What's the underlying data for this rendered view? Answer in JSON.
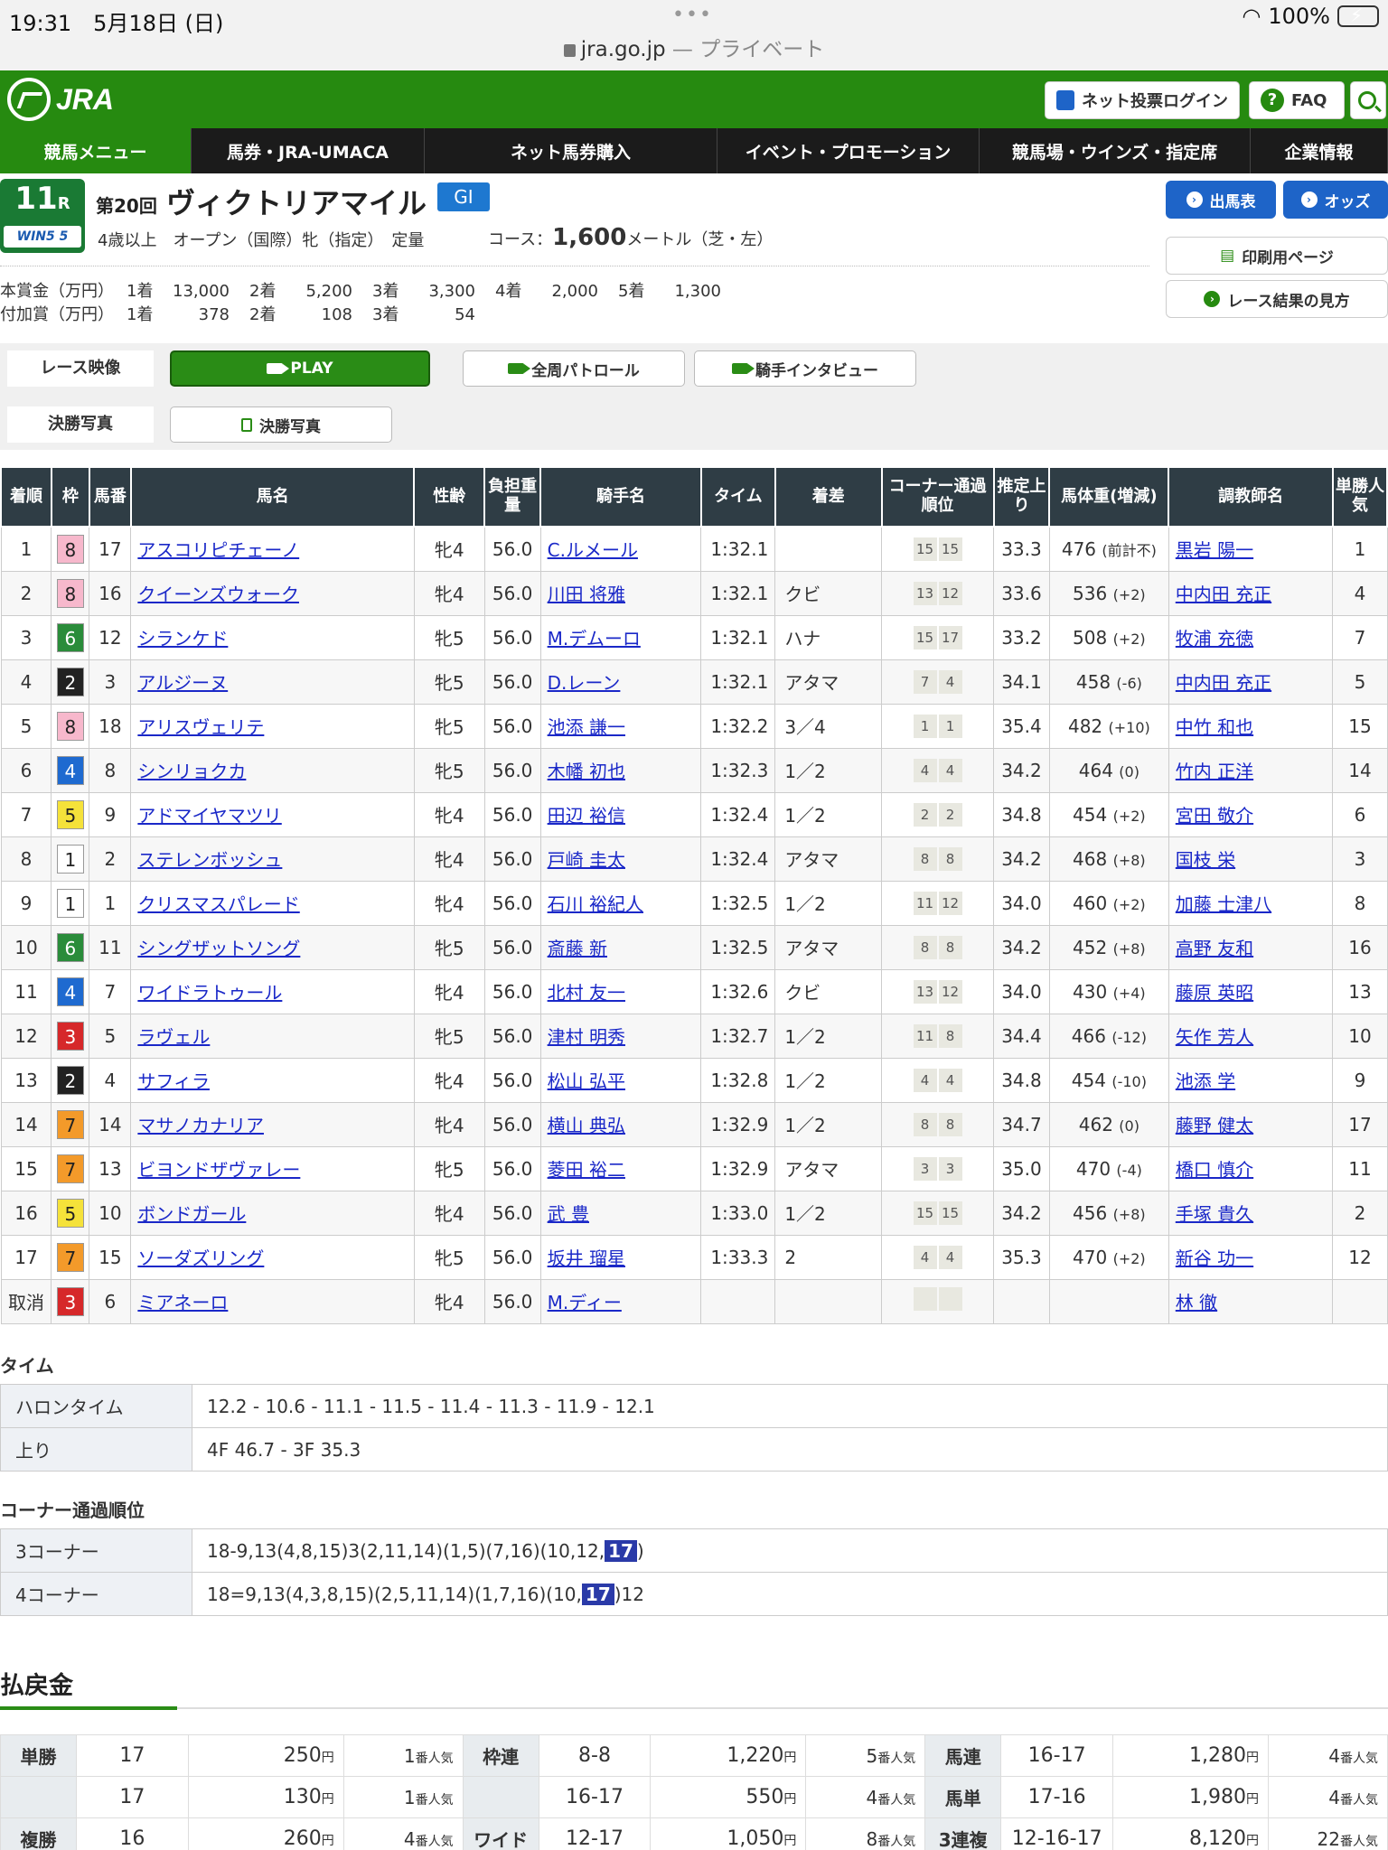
{
  "status": {
    "time": "19:31",
    "date": "5月18日 (日)",
    "battery": "100%"
  },
  "browser": {
    "domain": "jra.go.jp",
    "mode": "— プライベート"
  },
  "header": {
    "logo": "JRA",
    "login_label": "ネット投票ログイン",
    "faq_label": "FAQ"
  },
  "nav": [
    {
      "label": "競馬メニュー",
      "w": 212
    },
    {
      "label": "馬券・JRA-UMACA",
      "w": 258
    },
    {
      "label": "ネット馬券購入",
      "w": 324
    },
    {
      "label": "イベント・プロモーション",
      "w": 290
    },
    {
      "label": "競馬場・ウインズ・指定席",
      "w": 300
    },
    {
      "label": "企業情報",
      "w": 152
    }
  ],
  "race": {
    "number": "11",
    "r": "R",
    "win5": "WIN5 5",
    "count": "第20回",
    "name": "ヴィクトリアマイル",
    "grade": "GI",
    "conditions": "4歳以上　オープン（国際）牝（指定）　定量",
    "course_label": "コース：",
    "distance": "1,600",
    "course_unit": "メートル（芝・左）",
    "prize_main": {
      "label": "本賞金（万円）",
      "items": [
        "1着",
        "13,000",
        "2着",
        "5,200",
        "3着",
        "3,300",
        "4着",
        "2,000",
        "5着",
        "1,300"
      ]
    },
    "prize_add": {
      "label": "付加賞（万円）",
      "items": [
        "1着",
        "378",
        "2着",
        "108",
        "3着",
        "54"
      ]
    }
  },
  "side_buttons": {
    "entries": "出馬表",
    "odds": "オッズ",
    "print": "印刷用ページ",
    "guide": "レース結果の見方"
  },
  "video": {
    "label": "レース映像",
    "play": "PLAY",
    "patrol": "全周パトロール",
    "interview": "騎手インタビュー",
    "photo_label": "決勝写真",
    "photo_btn": "決勝写真"
  },
  "table_headers": [
    "着順",
    "枠",
    "馬番",
    "馬名",
    "性齢",
    "負担重量",
    "騎手名",
    "タイム",
    "着差",
    "コーナー通過順位",
    "推定上り",
    "馬体重(増減)",
    "調教師名",
    "単勝人気"
  ],
  "waku_colors": {
    "1": {
      "bg": "#ffffff",
      "fg": "#222222"
    },
    "2": {
      "bg": "#222222",
      "fg": "#ffffff"
    },
    "3": {
      "bg": "#d6282a",
      "fg": "#ffffff"
    },
    "4": {
      "bg": "#1e6ad0",
      "fg": "#ffffff"
    },
    "5": {
      "bg": "#f5e23a",
      "fg": "#222222"
    },
    "6": {
      "bg": "#2a8c3a",
      "fg": "#ffffff"
    },
    "7": {
      "bg": "#f39a2a",
      "fg": "#222222"
    },
    "8": {
      "bg": "#f7b8cc",
      "fg": "#222222"
    }
  },
  "results": [
    {
      "place": "1",
      "waku": "8",
      "num": "17",
      "horse": "アスコリピチェーノ",
      "sex_age": "牝4",
      "weight": "56.0",
      "jockey": "C.ルメール",
      "time": "1:32.1",
      "margin": "",
      "corners": [
        "15",
        "15"
      ],
      "last3f": "33.3",
      "body": "476",
      "diff": "(前計不)",
      "trainer": "黒岩 陽一",
      "pop": "1"
    },
    {
      "place": "2",
      "waku": "8",
      "num": "16",
      "horse": "クイーンズウォーク",
      "sex_age": "牝4",
      "weight": "56.0",
      "jockey": "川田 将雅",
      "time": "1:32.1",
      "margin": "クビ",
      "corners": [
        "13",
        "12"
      ],
      "last3f": "33.6",
      "body": "536",
      "diff": "(+2)",
      "trainer": "中内田 充正",
      "pop": "4"
    },
    {
      "place": "3",
      "waku": "6",
      "num": "12",
      "horse": "シランケド",
      "sex_age": "牝5",
      "weight": "56.0",
      "jockey": "M.デムーロ",
      "time": "1:32.1",
      "margin": "ハナ",
      "corners": [
        "15",
        "17"
      ],
      "last3f": "33.2",
      "body": "508",
      "diff": "(+2)",
      "trainer": "牧浦 充徳",
      "pop": "7"
    },
    {
      "place": "4",
      "waku": "2",
      "num": "3",
      "horse": "アルジーヌ",
      "sex_age": "牝5",
      "weight": "56.0",
      "jockey": "D.レーン",
      "time": "1:32.1",
      "margin": "アタマ",
      "corners": [
        "7",
        "4"
      ],
      "last3f": "34.1",
      "body": "458",
      "diff": "(-6)",
      "trainer": "中内田 充正",
      "pop": "5"
    },
    {
      "place": "5",
      "waku": "8",
      "num": "18",
      "horse": "アリスヴェリテ",
      "sex_age": "牝5",
      "weight": "56.0",
      "jockey": "池添 謙一",
      "time": "1:32.2",
      "margin": "3／4",
      "corners": [
        "1",
        "1"
      ],
      "last3f": "35.4",
      "body": "482",
      "diff": "(+10)",
      "trainer": "中竹 和也",
      "pop": "15"
    },
    {
      "place": "6",
      "waku": "4",
      "num": "8",
      "horse": "シンリョクカ",
      "sex_age": "牝5",
      "weight": "56.0",
      "jockey": "木幡 初也",
      "time": "1:32.3",
      "margin": "1／2",
      "corners": [
        "4",
        "4"
      ],
      "last3f": "34.2",
      "body": "464",
      "diff": "(0)",
      "trainer": "竹内 正洋",
      "pop": "14"
    },
    {
      "place": "7",
      "waku": "5",
      "num": "9",
      "horse": "アドマイヤマツリ",
      "sex_age": "牝4",
      "weight": "56.0",
      "jockey": "田辺 裕信",
      "time": "1:32.4",
      "margin": "1／2",
      "corners": [
        "2",
        "2"
      ],
      "last3f": "34.8",
      "body": "454",
      "diff": "(+2)",
      "trainer": "宮田 敬介",
      "pop": "6"
    },
    {
      "place": "8",
      "waku": "1",
      "num": "2",
      "horse": "ステレンボッシュ",
      "sex_age": "牝4",
      "weight": "56.0",
      "jockey": "戸崎 圭太",
      "time": "1:32.4",
      "margin": "アタマ",
      "corners": [
        "8",
        "8"
      ],
      "last3f": "34.2",
      "body": "468",
      "diff": "(+8)",
      "trainer": "国枝 栄",
      "pop": "3"
    },
    {
      "place": "9",
      "waku": "1",
      "num": "1",
      "horse": "クリスマスパレード",
      "sex_age": "牝4",
      "weight": "56.0",
      "jockey": "石川 裕紀人",
      "time": "1:32.5",
      "margin": "1／2",
      "corners": [
        "11",
        "12"
      ],
      "last3f": "34.0",
      "body": "460",
      "diff": "(+2)",
      "trainer": "加藤 士津八",
      "pop": "8"
    },
    {
      "place": "10",
      "waku": "6",
      "num": "11",
      "horse": "シングザットソング",
      "sex_age": "牝5",
      "weight": "56.0",
      "jockey": "斎藤 新",
      "time": "1:32.5",
      "margin": "アタマ",
      "corners": [
        "8",
        "8"
      ],
      "last3f": "34.2",
      "body": "452",
      "diff": "(+8)",
      "trainer": "高野 友和",
      "pop": "16"
    },
    {
      "place": "11",
      "waku": "4",
      "num": "7",
      "horse": "ワイドラトゥール",
      "sex_age": "牝4",
      "weight": "56.0",
      "jockey": "北村 友一",
      "time": "1:32.6",
      "margin": "クビ",
      "corners": [
        "13",
        "12"
      ],
      "last3f": "34.0",
      "body": "430",
      "diff": "(+4)",
      "trainer": "藤原 英昭",
      "pop": "13"
    },
    {
      "place": "12",
      "waku": "3",
      "num": "5",
      "horse": "ラヴェル",
      "sex_age": "牝5",
      "weight": "56.0",
      "jockey": "津村 明秀",
      "time": "1:32.7",
      "margin": "1／2",
      "corners": [
        "11",
        "8"
      ],
      "last3f": "34.4",
      "body": "466",
      "diff": "(-12)",
      "trainer": "矢作 芳人",
      "pop": "10"
    },
    {
      "place": "13",
      "waku": "2",
      "num": "4",
      "horse": "サフィラ",
      "sex_age": "牝4",
      "weight": "56.0",
      "jockey": "松山 弘平",
      "time": "1:32.8",
      "margin": "1／2",
      "corners": [
        "4",
        "4"
      ],
      "last3f": "34.8",
      "body": "454",
      "diff": "(-10)",
      "trainer": "池添 学",
      "pop": "9"
    },
    {
      "place": "14",
      "waku": "7",
      "num": "14",
      "horse": "マサノカナリア",
      "sex_age": "牝4",
      "weight": "56.0",
      "jockey": "横山 典弘",
      "time": "1:32.9",
      "margin": "1／2",
      "corners": [
        "8",
        "8"
      ],
      "last3f": "34.7",
      "body": "462",
      "diff": "(0)",
      "trainer": "藤野 健太",
      "pop": "17"
    },
    {
      "place": "15",
      "waku": "7",
      "num": "13",
      "horse": "ビヨンドザヴァレー",
      "sex_age": "牝5",
      "weight": "56.0",
      "jockey": "菱田 裕二",
      "time": "1:32.9",
      "margin": "アタマ",
      "corners": [
        "3",
        "3"
      ],
      "last3f": "35.0",
      "body": "470",
      "diff": "(-4)",
      "trainer": "橋口 慎介",
      "pop": "11"
    },
    {
      "place": "16",
      "waku": "5",
      "num": "10",
      "horse": "ボンドガール",
      "sex_age": "牝4",
      "weight": "56.0",
      "jockey": "武 豊",
      "time": "1:33.0",
      "margin": "1／2",
      "corners": [
        "15",
        "15"
      ],
      "last3f": "34.2",
      "body": "456",
      "diff": "(+8)",
      "trainer": "手塚 貴久",
      "pop": "2"
    },
    {
      "place": "17",
      "waku": "7",
      "num": "15",
      "horse": "ソーダズリング",
      "sex_age": "牝5",
      "weight": "56.0",
      "jockey": "坂井 瑠星",
      "time": "1:33.3",
      "margin": "2",
      "corners": [
        "4",
        "4"
      ],
      "last3f": "35.3",
      "body": "470",
      "diff": "(+2)",
      "trainer": "新谷 功一",
      "pop": "12"
    },
    {
      "place": "取消",
      "waku": "3",
      "num": "6",
      "horse": "ミアネーロ",
      "sex_age": "牝4",
      "weight": "56.0",
      "jockey": "M.ディー",
      "time": "",
      "margin": "",
      "corners": [
        "",
        ""
      ],
      "last3f": "",
      "body": "",
      "diff": "",
      "trainer": "林 徹",
      "pop": ""
    }
  ],
  "time_section": {
    "title": "タイム",
    "rows": [
      {
        "k": "ハロンタイム",
        "v": "12.2 - 10.6 - 11.1 - 11.5 - 11.4 - 11.3 - 11.9 - 12.1"
      },
      {
        "k": "上り",
        "v": "4F 46.7 - 3F 35.3"
      }
    ]
  },
  "corner_section": {
    "title": "コーナー通過順位",
    "rows": [
      {
        "k": "3コーナー",
        "pre": "18-9,13(4,8,15)3(2,11,14)(1,5)(7,16)(10,12,",
        "hl": "17",
        "post": ")"
      },
      {
        "k": "4コーナー",
        "pre": "18=9,13(4,3,8,15)(2,5,11,14)(1,7,16)(10,",
        "hl": "17",
        "post": ")12"
      }
    ]
  },
  "payout": {
    "title": "払戻金",
    "yen": "円",
    "ninki": "番人気",
    "rows": [
      [
        {
          "k": "単勝",
          "combo": "17",
          "amount": "250",
          "pop": "1"
        },
        {
          "k": "枠連",
          "combo": "8-8",
          "amount": "1,220",
          "pop": "5"
        },
        {
          "k": "馬連",
          "combo": "16-17",
          "amount": "1,280",
          "pop": "4"
        }
      ],
      [
        {
          "k": "",
          "combo": "17",
          "amount": "130",
          "pop": "1"
        },
        {
          "k": "",
          "combo": "16-17",
          "amount": "550",
          "pop": "4"
        },
        {
          "k": "馬単",
          "combo": "17-16",
          "amount": "1,980",
          "pop": "4"
        }
      ],
      [
        {
          "k": "複勝",
          "combo": "16",
          "amount": "260",
          "pop": "4"
        },
        {
          "k": "ワイド",
          "combo": "12-17",
          "amount": "1,050",
          "pop": "8"
        },
        {
          "k": "3連複",
          "combo": "12-16-17",
          "amount": "8,120",
          "pop": "22"
        }
      ]
    ]
  }
}
